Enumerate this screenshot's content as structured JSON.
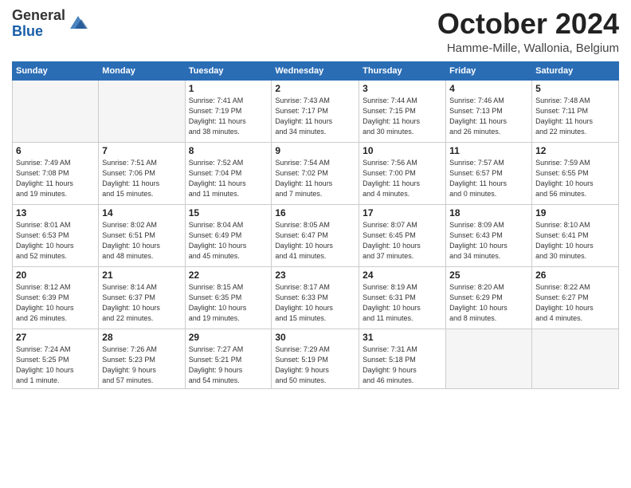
{
  "logo": {
    "general": "General",
    "blue": "Blue"
  },
  "header": {
    "month": "October 2024",
    "location": "Hamme-Mille, Wallonia, Belgium"
  },
  "weekdays": [
    "Sunday",
    "Monday",
    "Tuesday",
    "Wednesday",
    "Thursday",
    "Friday",
    "Saturday"
  ],
  "weeks": [
    [
      {
        "day": "",
        "info": ""
      },
      {
        "day": "",
        "info": ""
      },
      {
        "day": "1",
        "info": "Sunrise: 7:41 AM\nSunset: 7:19 PM\nDaylight: 11 hours\nand 38 minutes."
      },
      {
        "day": "2",
        "info": "Sunrise: 7:43 AM\nSunset: 7:17 PM\nDaylight: 11 hours\nand 34 minutes."
      },
      {
        "day": "3",
        "info": "Sunrise: 7:44 AM\nSunset: 7:15 PM\nDaylight: 11 hours\nand 30 minutes."
      },
      {
        "day": "4",
        "info": "Sunrise: 7:46 AM\nSunset: 7:13 PM\nDaylight: 11 hours\nand 26 minutes."
      },
      {
        "day": "5",
        "info": "Sunrise: 7:48 AM\nSunset: 7:11 PM\nDaylight: 11 hours\nand 22 minutes."
      }
    ],
    [
      {
        "day": "6",
        "info": "Sunrise: 7:49 AM\nSunset: 7:08 PM\nDaylight: 11 hours\nand 19 minutes."
      },
      {
        "day": "7",
        "info": "Sunrise: 7:51 AM\nSunset: 7:06 PM\nDaylight: 11 hours\nand 15 minutes."
      },
      {
        "day": "8",
        "info": "Sunrise: 7:52 AM\nSunset: 7:04 PM\nDaylight: 11 hours\nand 11 minutes."
      },
      {
        "day": "9",
        "info": "Sunrise: 7:54 AM\nSunset: 7:02 PM\nDaylight: 11 hours\nand 7 minutes."
      },
      {
        "day": "10",
        "info": "Sunrise: 7:56 AM\nSunset: 7:00 PM\nDaylight: 11 hours\nand 4 minutes."
      },
      {
        "day": "11",
        "info": "Sunrise: 7:57 AM\nSunset: 6:57 PM\nDaylight: 11 hours\nand 0 minutes."
      },
      {
        "day": "12",
        "info": "Sunrise: 7:59 AM\nSunset: 6:55 PM\nDaylight: 10 hours\nand 56 minutes."
      }
    ],
    [
      {
        "day": "13",
        "info": "Sunrise: 8:01 AM\nSunset: 6:53 PM\nDaylight: 10 hours\nand 52 minutes."
      },
      {
        "day": "14",
        "info": "Sunrise: 8:02 AM\nSunset: 6:51 PM\nDaylight: 10 hours\nand 48 minutes."
      },
      {
        "day": "15",
        "info": "Sunrise: 8:04 AM\nSunset: 6:49 PM\nDaylight: 10 hours\nand 45 minutes."
      },
      {
        "day": "16",
        "info": "Sunrise: 8:05 AM\nSunset: 6:47 PM\nDaylight: 10 hours\nand 41 minutes."
      },
      {
        "day": "17",
        "info": "Sunrise: 8:07 AM\nSunset: 6:45 PM\nDaylight: 10 hours\nand 37 minutes."
      },
      {
        "day": "18",
        "info": "Sunrise: 8:09 AM\nSunset: 6:43 PM\nDaylight: 10 hours\nand 34 minutes."
      },
      {
        "day": "19",
        "info": "Sunrise: 8:10 AM\nSunset: 6:41 PM\nDaylight: 10 hours\nand 30 minutes."
      }
    ],
    [
      {
        "day": "20",
        "info": "Sunrise: 8:12 AM\nSunset: 6:39 PM\nDaylight: 10 hours\nand 26 minutes."
      },
      {
        "day": "21",
        "info": "Sunrise: 8:14 AM\nSunset: 6:37 PM\nDaylight: 10 hours\nand 22 minutes."
      },
      {
        "day": "22",
        "info": "Sunrise: 8:15 AM\nSunset: 6:35 PM\nDaylight: 10 hours\nand 19 minutes."
      },
      {
        "day": "23",
        "info": "Sunrise: 8:17 AM\nSunset: 6:33 PM\nDaylight: 10 hours\nand 15 minutes."
      },
      {
        "day": "24",
        "info": "Sunrise: 8:19 AM\nSunset: 6:31 PM\nDaylight: 10 hours\nand 11 minutes."
      },
      {
        "day": "25",
        "info": "Sunrise: 8:20 AM\nSunset: 6:29 PM\nDaylight: 10 hours\nand 8 minutes."
      },
      {
        "day": "26",
        "info": "Sunrise: 8:22 AM\nSunset: 6:27 PM\nDaylight: 10 hours\nand 4 minutes."
      }
    ],
    [
      {
        "day": "27",
        "info": "Sunrise: 7:24 AM\nSunset: 5:25 PM\nDaylight: 10 hours\nand 1 minute."
      },
      {
        "day": "28",
        "info": "Sunrise: 7:26 AM\nSunset: 5:23 PM\nDaylight: 9 hours\nand 57 minutes."
      },
      {
        "day": "29",
        "info": "Sunrise: 7:27 AM\nSunset: 5:21 PM\nDaylight: 9 hours\nand 54 minutes."
      },
      {
        "day": "30",
        "info": "Sunrise: 7:29 AM\nSunset: 5:19 PM\nDaylight: 9 hours\nand 50 minutes."
      },
      {
        "day": "31",
        "info": "Sunrise: 7:31 AM\nSunset: 5:18 PM\nDaylight: 9 hours\nand 46 minutes."
      },
      {
        "day": "",
        "info": ""
      },
      {
        "day": "",
        "info": ""
      }
    ]
  ]
}
